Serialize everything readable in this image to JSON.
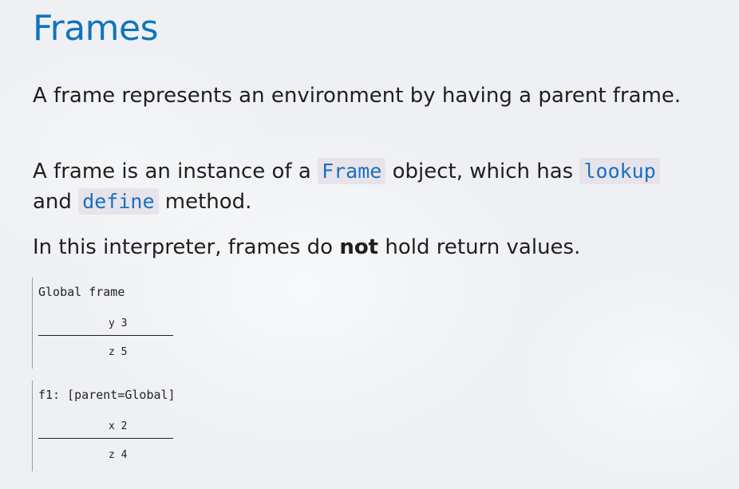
{
  "heading": {
    "title": "Frames"
  },
  "paragraphs": {
    "p1": "A frame represents an environment by having a parent frame.",
    "p2_pre": "A frame is an instance of a ",
    "p2_code1": "Frame",
    "p2_mid1": " object, which has ",
    "p2_code2": "lookup",
    "p2_mid2": " and ",
    "p2_code3": "define",
    "p2_post": " method.",
    "p3_pre": "In this interpreter, frames do ",
    "p3_bold": "not",
    "p3_post": " hold return values."
  },
  "frames": [
    {
      "title": "Global frame",
      "bindings": [
        "y 3",
        "z 5"
      ]
    },
    {
      "title": "f1: [parent=Global]",
      "bindings": [
        "x 2",
        "z 4"
      ]
    }
  ],
  "colors": {
    "title": "#0f74bd",
    "code_text": "#1a6fc1",
    "code_bg": "#e6e4ea"
  }
}
